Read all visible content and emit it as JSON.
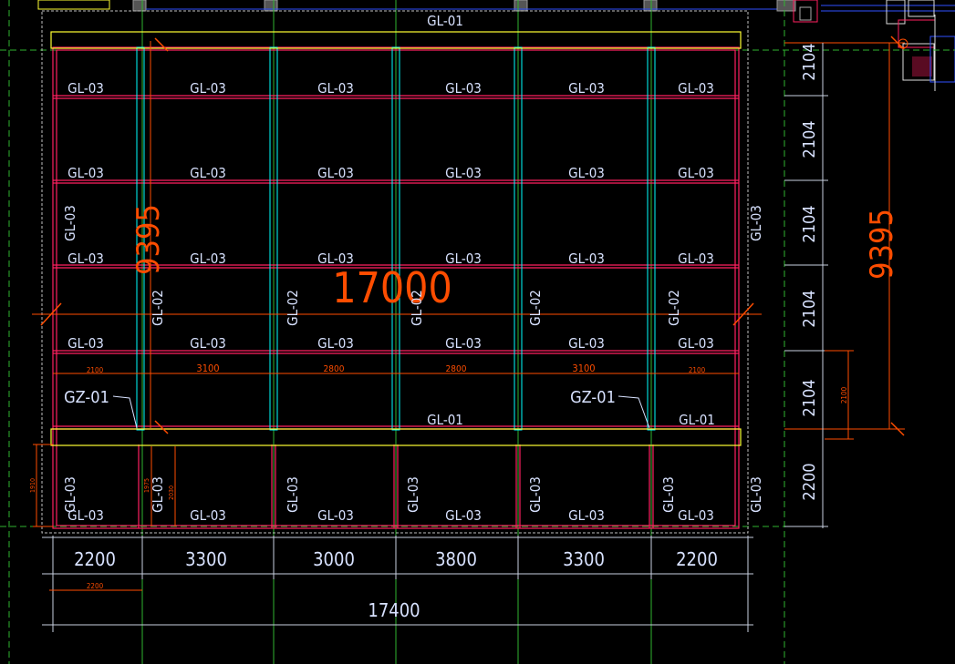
{
  "viewport": {
    "background": "#000000"
  },
  "colors": {
    "beam_line": "#ff2060",
    "cyan": "#00ffff",
    "yellow": "#ffff33",
    "label": "#d8e2ff",
    "dim_white": "#c8d0e0",
    "dim_orange": "#ff4d00",
    "grid_green": "#2fb52f",
    "grid_white": "#bfbfbf",
    "blue": "#3050ff"
  },
  "labels": {
    "gl01_top": "GL-01",
    "gl01_bottom_mid": "GL-01",
    "gl01_bottom_right": "GL-01",
    "gl02": "GL-02",
    "gl03": "GL-03",
    "gz01_left": "GZ-01",
    "gz01_right": "GZ-01"
  },
  "dims": {
    "overall_width": "17400",
    "center_big": "17000",
    "height_total_right": "9395",
    "height_total_left": "9395",
    "bottom_bays": [
      "2200",
      "3300",
      "3000",
      "3800",
      "3300",
      "2200"
    ],
    "bottom_small": "2200",
    "right_rows": [
      "2104",
      "2104",
      "2104",
      "2104",
      "2104",
      "2200"
    ],
    "right_small": "2100",
    "mid_spans": [
      "2100",
      "3100",
      "2800",
      "2800",
      "3100",
      "2100"
    ],
    "left_1910": "1910",
    "left_1975": "1975",
    "left_2030": "2030"
  },
  "icons": [
    "crosshair-icon",
    "grid-axis-icon"
  ]
}
